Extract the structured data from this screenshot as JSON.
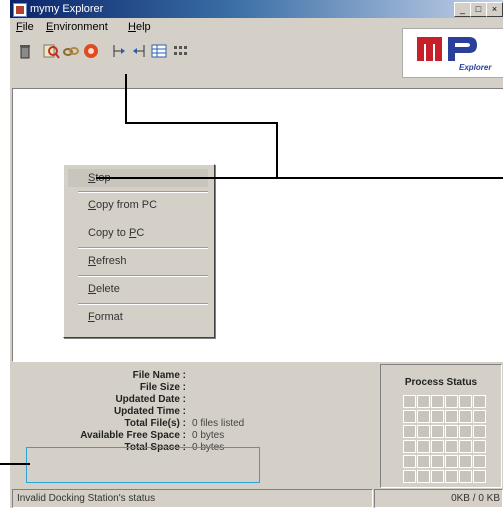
{
  "window": {
    "title": "mymy Explorer"
  },
  "title_buttons": {
    "minimize": "_",
    "maximize": "□",
    "close": "×"
  },
  "menu": [
    {
      "label": "File",
      "key": "F",
      "rest": "ile"
    },
    {
      "label": "Environment",
      "key": "E",
      "rest": "nvironment"
    },
    {
      "label": "Help",
      "key": "H",
      "rest": "elp"
    }
  ],
  "toolbar": {
    "icons": [
      "trash-icon",
      "search-icon",
      "link-icon",
      "stop-icon",
      "copy-from-pc-icon",
      "copy-to-pc-icon",
      "details-view-icon",
      "list-view-icon"
    ]
  },
  "logo": {
    "mark": "MP",
    "sub": "Explorer"
  },
  "context_menu": {
    "items": [
      {
        "label": "Stop",
        "key": "S",
        "rest": "top"
      },
      {
        "label": "Copy from PC",
        "key": "C",
        "rest": "opy from PC"
      },
      {
        "label": "Copy to PC",
        "pre": "Copy to ",
        "key": "P",
        "rest": "C"
      },
      {
        "label": "Refresh",
        "key": "R",
        "rest": "efresh"
      },
      {
        "label": "Delete",
        "key": "D",
        "rest": "elete"
      },
      {
        "label": "Format",
        "key": "F",
        "rest": "ormat"
      }
    ]
  },
  "info": {
    "file_name_label": "File Name :",
    "file_size_label": "File Size :",
    "updated_date_label": "Updated Date :",
    "updated_time_label": "Updated Time :",
    "total_files_label": "Total File(s) :",
    "total_files_value": "0 files listed",
    "available_space_label": "Available Free Space :",
    "available_space_value": "0 bytes",
    "total_space_label": "Total Space :",
    "total_space_value": "0 bytes"
  },
  "process_status": {
    "label": "Process Status"
  },
  "statusbar": {
    "message": "Invalid Docking Station's status",
    "transfer": "0KB / 0 KB"
  },
  "colors": {
    "highlight_box": "#29a3d8",
    "callout_line": "#000000"
  }
}
